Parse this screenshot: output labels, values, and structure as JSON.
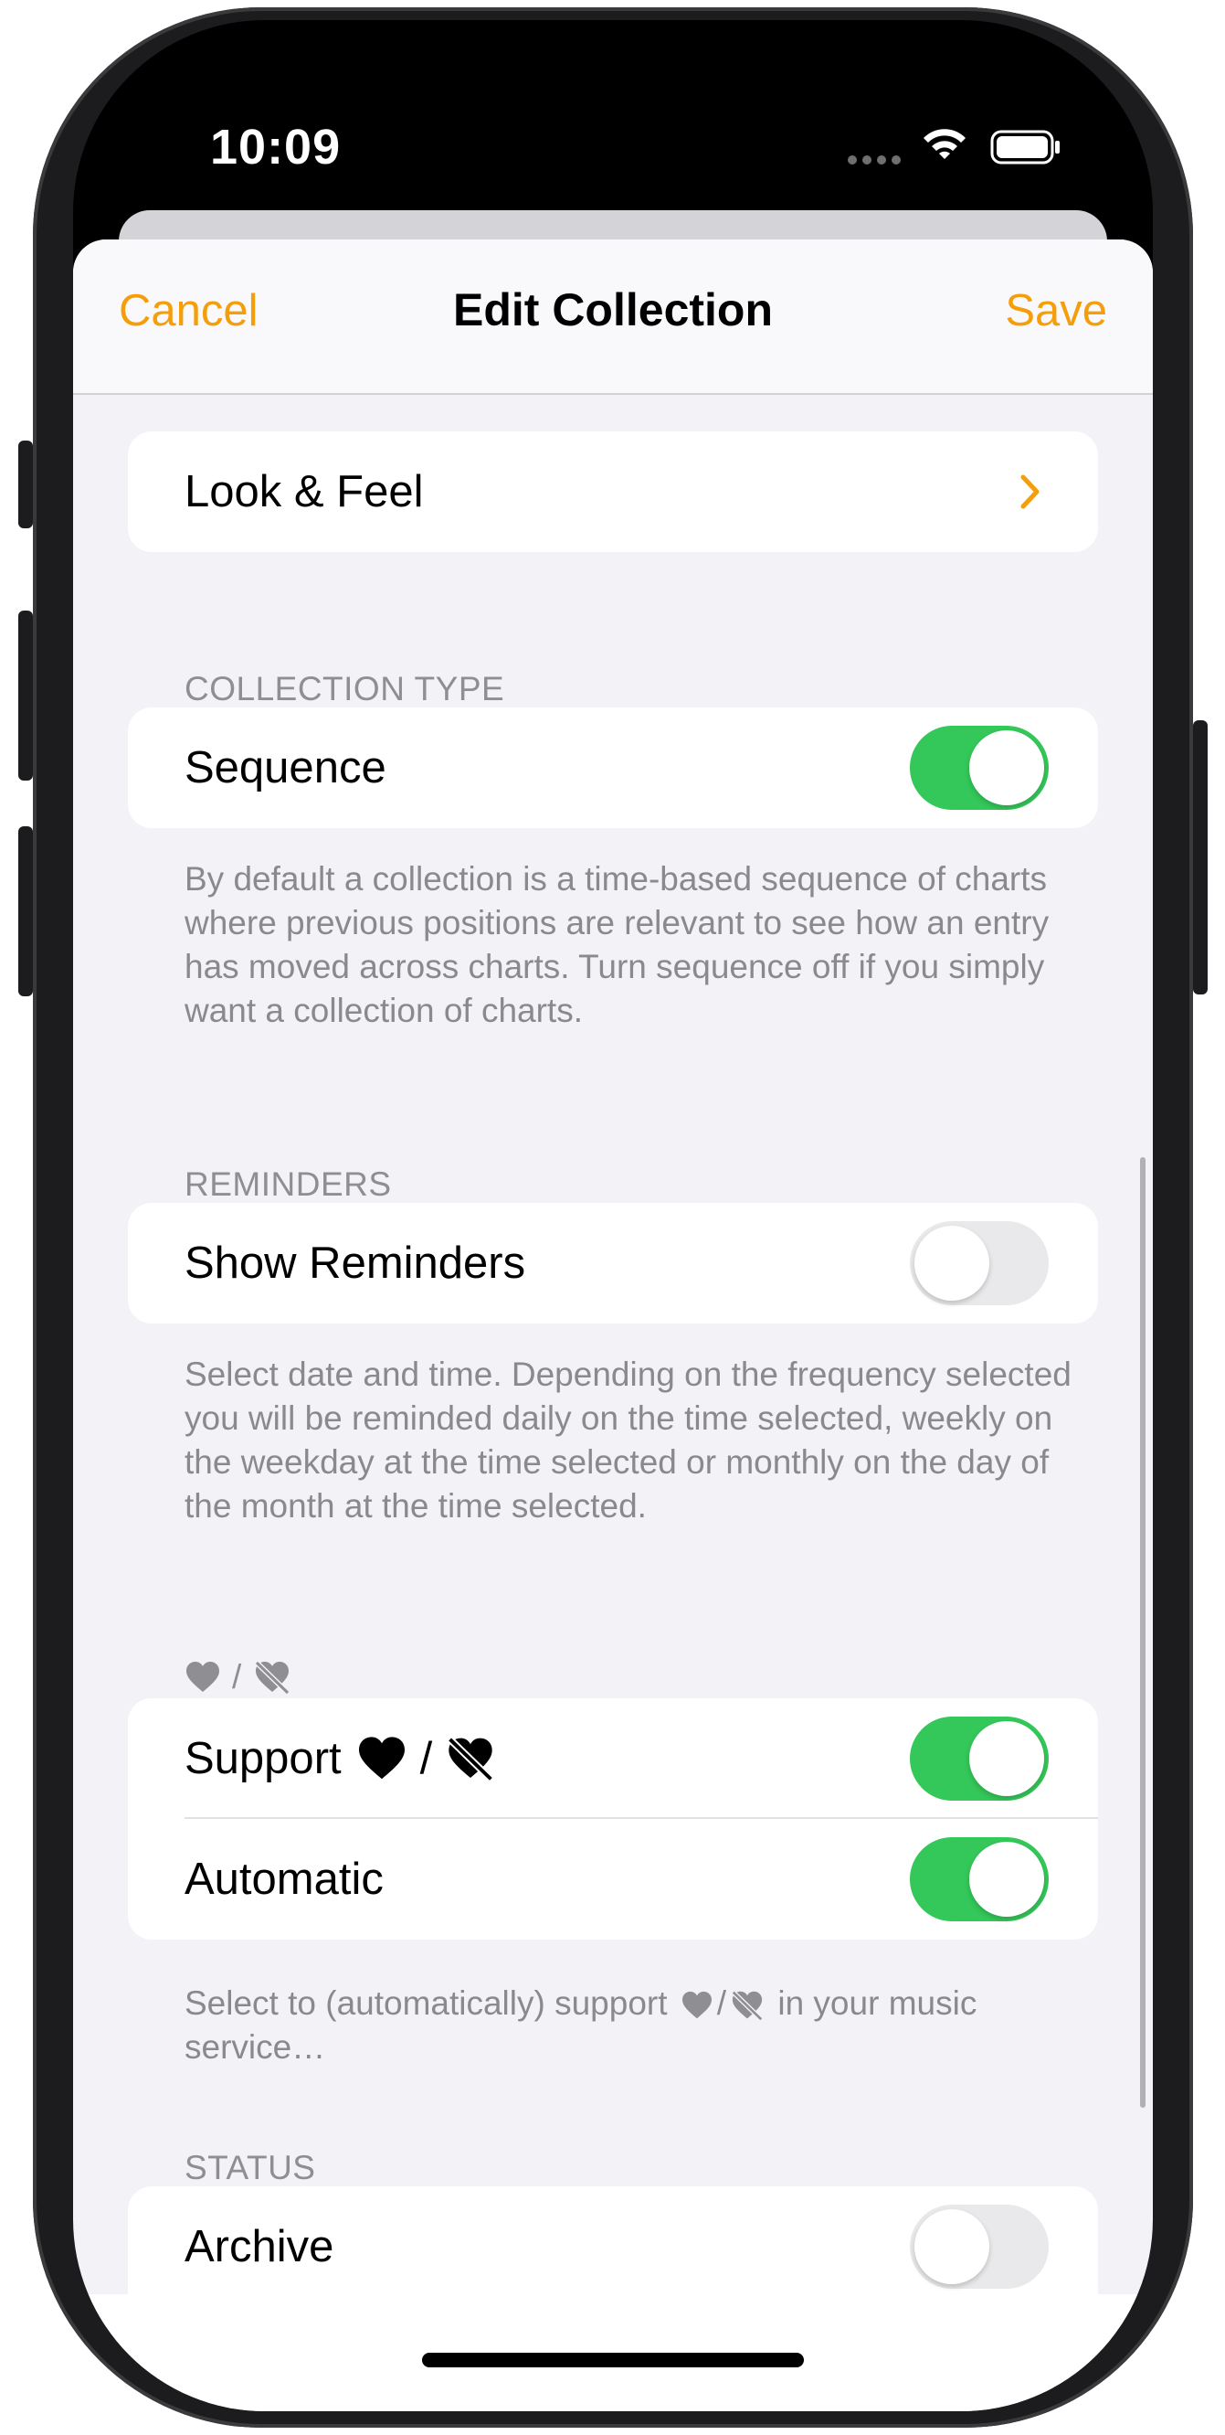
{
  "status_bar": {
    "time": "10:09"
  },
  "nav": {
    "cancel_label": "Cancel",
    "title": "Edit Collection",
    "save_label": "Save"
  },
  "look_feel": {
    "label": "Look & Feel"
  },
  "collection_type": {
    "header": "COLLECTION TYPE",
    "sequence_label": "Sequence",
    "sequence_on": true,
    "footer": "By default a collection is a time-based sequence of charts where previous positions are relevant to see how an entry has moved across charts. Turn sequence off if you simply want a collection of charts."
  },
  "reminders": {
    "header": "REMINDERS",
    "show_label": "Show Reminders",
    "show_on": false,
    "footer": "Select date and time. Depending on the frequency selected you will be reminded daily on the time selected, weekly on the weekday at the time selected or monthly on the day of the month at the time selected."
  },
  "love": {
    "header_sep": "/",
    "support_label": "Support",
    "support_sep": "/",
    "support_on": true,
    "automatic_label": "Automatic",
    "automatic_on": true,
    "footer_pre": "Select to (automatically) support",
    "footer_sep": "/",
    "footer_post": "in your music service…"
  },
  "status": {
    "header": "STATUS",
    "archive_label": "Archive",
    "archive_on": false
  },
  "colors": {
    "accent": "#f59e0b",
    "toggle_on": "#34c759",
    "toggle_off": "#e9e9eb"
  },
  "icons": [
    "wifi-icon",
    "battery-icon",
    "chevron-right-icon",
    "heart-icon",
    "heart-slash-icon"
  ]
}
